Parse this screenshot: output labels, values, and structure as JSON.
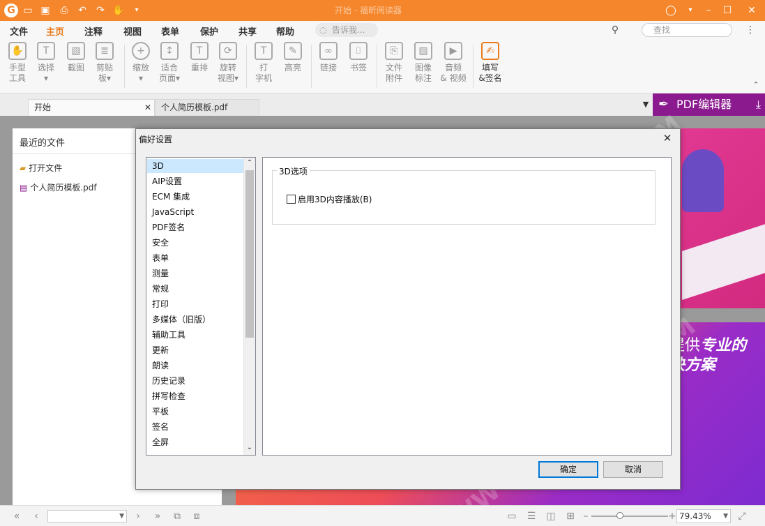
{
  "window": {
    "title": "开始 - 福昕阅读器"
  },
  "menu": [
    "文件",
    "主页",
    "注释",
    "视图",
    "表单",
    "保护",
    "共享",
    "帮助"
  ],
  "menu_active": "主页",
  "tell_me": {
    "placeholder": "告诉我..."
  },
  "search": {
    "placeholder": "查找"
  },
  "ribbon": {
    "hand": [
      "手型",
      "工具"
    ],
    "select": [
      "选择",
      "▾"
    ],
    "snapshot": [
      "截图",
      ""
    ],
    "clipboard": [
      "剪贴",
      "板▾"
    ],
    "zoom": [
      "缩放",
      "▾"
    ],
    "fit": [
      "适合",
      "页面▾"
    ],
    "reflow": [
      "重排",
      ""
    ],
    "rotate": [
      "旋转",
      "视图▾"
    ],
    "typewriter": [
      "打",
      "字机"
    ],
    "highlight": [
      "高亮",
      ""
    ],
    "link": [
      "链接",
      ""
    ],
    "bookmark": [
      "书签",
      ""
    ],
    "attach": [
      "文件",
      "附件"
    ],
    "image": [
      "图像",
      "标注"
    ],
    "media": [
      "音频",
      "& 视频"
    ],
    "fill_sign": [
      "填写",
      "&签名"
    ]
  },
  "tabs": {
    "start": "开始",
    "doc": "个人简历模板.pdf"
  },
  "pdf_editor": "PDF编辑器",
  "recent": {
    "title": "最近的文件",
    "open_file": "打开文件",
    "file": "个人简历模板.pdf"
  },
  "banner": {
    "line1a": "提供",
    "line1b": "专业的",
    "line2": "决方案"
  },
  "dialog": {
    "title": "偏好设置",
    "categories": [
      "3D",
      "AIP设置",
      "ECM 集成",
      "JavaScript",
      "PDF签名",
      "安全",
      "表单",
      "测量",
      "常规",
      "打印",
      "多媒体（旧版）",
      "辅助工具",
      "更新",
      "朗读",
      "历史记录",
      "拼写检查",
      "平板",
      "签名",
      "全屏"
    ],
    "selected": "3D",
    "group_title": "3D选项",
    "checkbox_label": "启用3D内容播放(B)",
    "checkbox_checked": false,
    "ok": "确定",
    "cancel": "取消"
  },
  "status": {
    "zoom": "79.43%"
  },
  "watermark": "WWW.WEIDOWN.COM",
  "colors": {
    "accent": "#f5862b",
    "editor": "#8b1a8f",
    "selection": "#cce8ff"
  }
}
